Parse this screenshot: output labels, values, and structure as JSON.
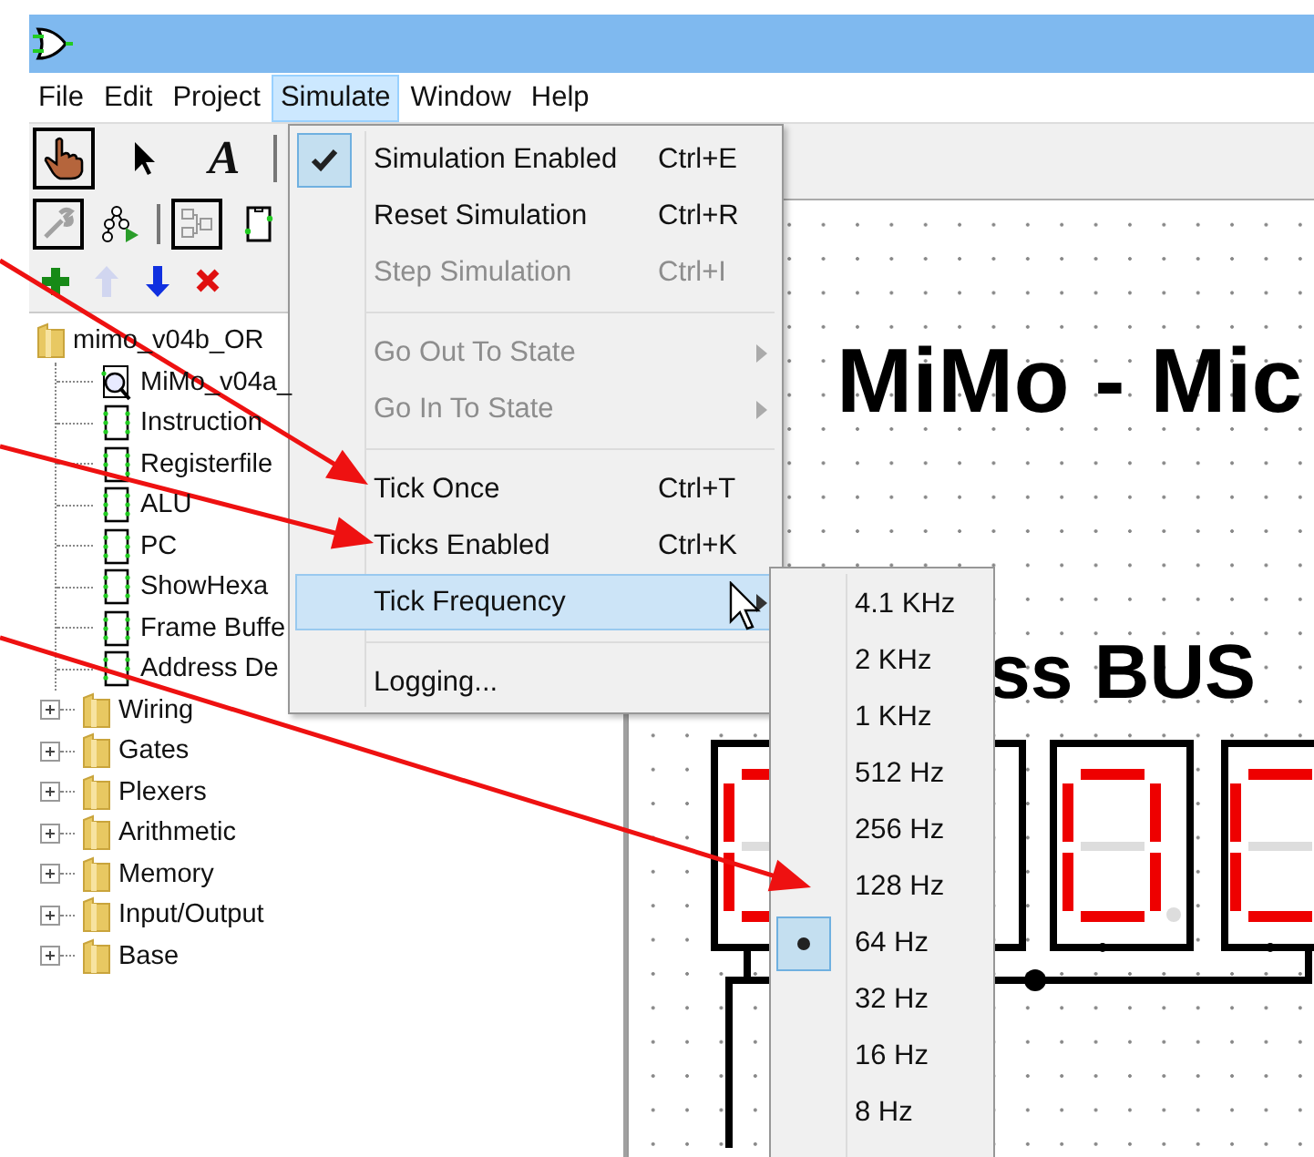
{
  "menu_bar": [
    {
      "label": "File",
      "selected": false
    },
    {
      "label": "Edit",
      "selected": false
    },
    {
      "label": "Project",
      "selected": false
    },
    {
      "label": "Simulate",
      "selected": true
    },
    {
      "label": "Window",
      "selected": false
    },
    {
      "label": "Help",
      "selected": false
    }
  ],
  "toolbar": {
    "tools": [
      {
        "kind": "hand",
        "selected": true
      },
      {
        "kind": "pointer",
        "selected": false
      },
      {
        "kind": "text",
        "glyph": "A",
        "selected": false
      }
    ],
    "views": [
      {
        "kind": "wrench",
        "selected": true,
        "disabled": true
      },
      {
        "kind": "sim-tree",
        "selected": false,
        "disabled": false
      },
      {
        "kind": "layout",
        "selected": true,
        "disabled": false
      },
      {
        "kind": "appearance",
        "selected": false,
        "disabled": false
      }
    ],
    "actions": [
      {
        "kind": "add",
        "disabled": false
      },
      {
        "kind": "move-up",
        "disabled": true
      },
      {
        "kind": "move-down",
        "disabled": false
      },
      {
        "kind": "remove",
        "disabled": false
      }
    ]
  },
  "tree": {
    "label": "mimo_v04b_OR",
    "children": [
      {
        "label": "MiMo_v04a_",
        "kind": "main"
      },
      {
        "label": "Instruction",
        "kind": "circuit"
      },
      {
        "label": "Registerfile",
        "kind": "circuit"
      },
      {
        "label": "ALU",
        "kind": "circuit"
      },
      {
        "label": "PC",
        "kind": "circuit"
      },
      {
        "label": "ShowHexa",
        "kind": "circuit"
      },
      {
        "label": "Frame Buffe",
        "kind": "circuit"
      },
      {
        "label": "Address De",
        "kind": "circuit"
      }
    ]
  },
  "libraries": [
    {
      "label": "Wiring",
      "expanded": false
    },
    {
      "label": "Gates",
      "expanded": false
    },
    {
      "label": "Plexers",
      "expanded": false
    },
    {
      "label": "Arithmetic",
      "expanded": false
    },
    {
      "label": "Memory",
      "expanded": false
    },
    {
      "label": "Input/Output",
      "expanded": false
    },
    {
      "label": "Base",
      "expanded": false
    }
  ],
  "canvas": {
    "title": "MiMo - Mic",
    "subtitle": "ss BUS"
  },
  "simulate_menu": {
    "items": [
      {
        "kind": "item",
        "label": "Simulation Enabled",
        "shortcut": "Ctrl+E",
        "checked": true,
        "disabled": false,
        "highlighted": false
      },
      {
        "kind": "item",
        "label": "Reset Simulation",
        "shortcut": "Ctrl+R",
        "checked": false,
        "disabled": false,
        "highlighted": false
      },
      {
        "kind": "item",
        "label": "Step Simulation",
        "shortcut": "Ctrl+I",
        "checked": false,
        "disabled": true,
        "highlighted": false
      },
      {
        "kind": "separator"
      },
      {
        "kind": "submenu",
        "label": "Go Out To State",
        "checked": false,
        "disabled": true,
        "highlighted": false
      },
      {
        "kind": "submenu",
        "label": "Go In To State",
        "checked": false,
        "disabled": true,
        "highlighted": false
      },
      {
        "kind": "separator"
      },
      {
        "kind": "item",
        "label": "Tick Once",
        "shortcut": "Ctrl+T",
        "checked": false,
        "disabled": false,
        "highlighted": false
      },
      {
        "kind": "item",
        "label": "Ticks Enabled",
        "shortcut": "Ctrl+K",
        "checked": false,
        "disabled": false,
        "highlighted": false
      },
      {
        "kind": "submenu",
        "label": "Tick Frequency",
        "checked": false,
        "disabled": false,
        "highlighted": true
      },
      {
        "kind": "separator"
      },
      {
        "kind": "item",
        "label": "Logging...",
        "checked": false,
        "disabled": false,
        "highlighted": false
      }
    ]
  },
  "tick_frequency_menu": {
    "items": [
      {
        "label": "4.1 KHz",
        "selected": false
      },
      {
        "label": "2 KHz",
        "selected": false
      },
      {
        "label": "1 KHz",
        "selected": false
      },
      {
        "label": "512 Hz",
        "selected": false
      },
      {
        "label": "256 Hz",
        "selected": false
      },
      {
        "label": "128 Hz",
        "selected": false
      },
      {
        "label": "64 Hz",
        "selected": true
      },
      {
        "label": "32 Hz",
        "selected": false
      },
      {
        "label": "16 Hz",
        "selected": false
      },
      {
        "label": "8 Hz",
        "selected": false
      }
    ]
  }
}
